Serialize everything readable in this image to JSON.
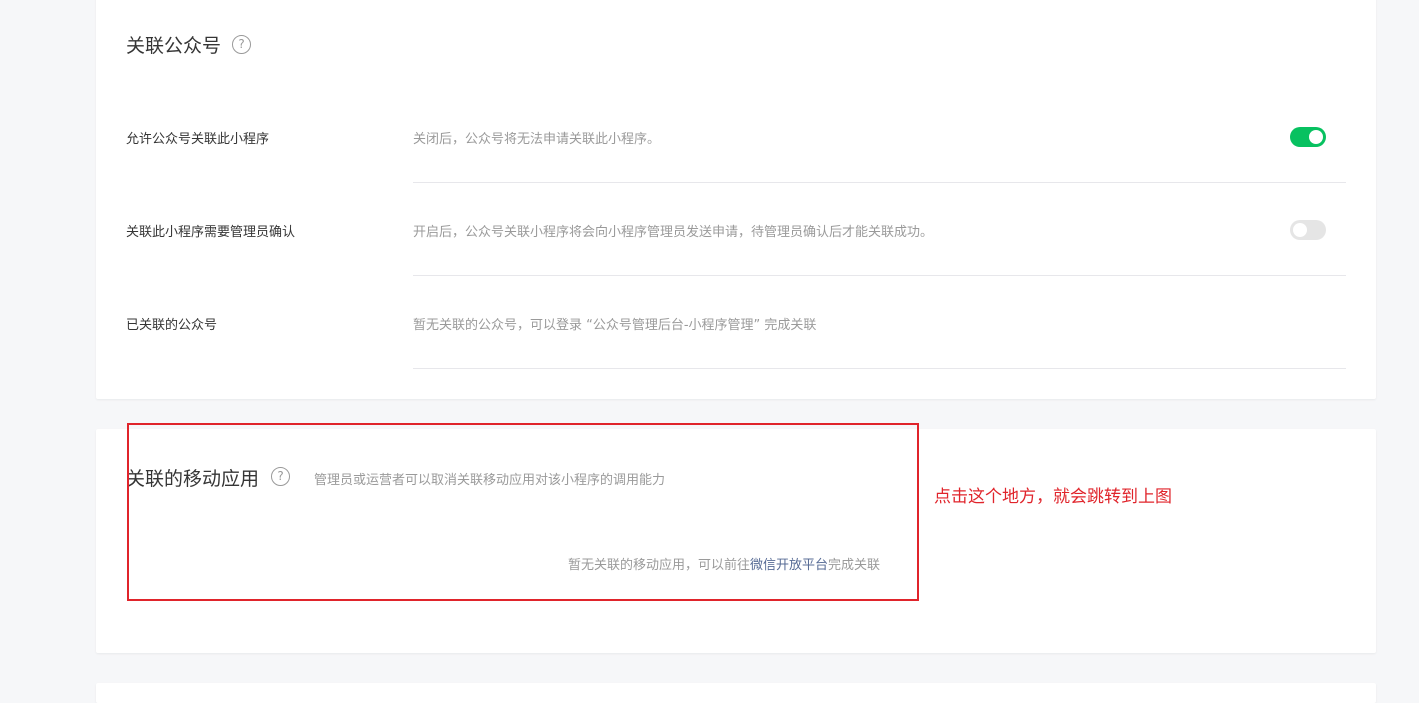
{
  "official_account_section": {
    "title": "关联公众号",
    "help_glyph": "?",
    "rows": [
      {
        "label": "允许公众号关联此小程序",
        "desc": "关闭后，公众号将无法申请关联此小程序。",
        "switch_on": true
      },
      {
        "label": "关联此小程序需要管理员确认",
        "desc": "开启后，公众号关联小程序将会向小程序管理员发送申请，待管理员确认后才能关联成功。",
        "switch_on": false
      },
      {
        "label": "已关联的公众号",
        "desc": "暂无关联的公众号，可以登录 “公众号管理后台-小程序管理” 完成关联"
      }
    ]
  },
  "mobile_app_section": {
    "title": "关联的移动应用",
    "help_glyph": "?",
    "subtitle": "管理员或运营者可以取消关联移动应用对该小程序的调用能力",
    "empty_prefix": "暂无关联的移动应用，可以前往",
    "empty_link": "微信开放平台",
    "empty_suffix": "完成关联"
  },
  "annotation": {
    "text": "点击这个地方，就会跳转到上图",
    "color": "#e0242b"
  },
  "colors": {
    "switch_on": "#07c160",
    "switch_off": "#e5e5e5",
    "link": "#576b95"
  }
}
